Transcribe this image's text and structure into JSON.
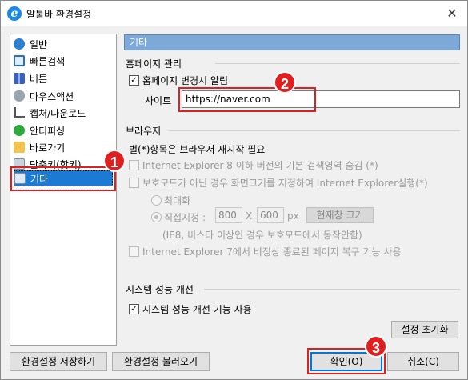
{
  "window": {
    "title": "알툴바 환경설정",
    "close_glyph": "✕"
  },
  "sidebar": {
    "items": [
      {
        "label": "일반",
        "icon": "general-icon"
      },
      {
        "label": "빠른검색",
        "icon": "quick-search-icon"
      },
      {
        "label": "버튼",
        "icon": "buttons-icon"
      },
      {
        "label": "마우스액션",
        "icon": "mouse-icon"
      },
      {
        "label": "캡처/다운로드",
        "icon": "capture-icon"
      },
      {
        "label": "안티피싱",
        "icon": "antiphishing-icon"
      },
      {
        "label": "바로가기",
        "icon": "shortcut-folder-icon"
      },
      {
        "label": "단축키(핫키)",
        "icon": "keyboard-icon"
      },
      {
        "label": "기타",
        "icon": "etc-icon",
        "selected": true
      }
    ]
  },
  "section": {
    "title": "기타"
  },
  "homepage": {
    "group_title": "홈페이지 관리",
    "notify_checkbox": "홈페이지 변경시 알림",
    "site_label": "사이트",
    "site_value": "https://naver.com"
  },
  "browser": {
    "group_title": "브라우저",
    "note": "별(*)항목은 브라우저 재시작 필요",
    "opt_ie8": "Internet Explorer 8 이하 버전의 기본 검색영역 숨김 (*)",
    "opt_protected": "보호모드가 아닌 경우 화면크기를 지정하여 Internet Explorer실행(*)",
    "radio_max": "최대화",
    "radio_custom": "직접지정 :",
    "width_value": "800",
    "times": "X",
    "height_value": "600",
    "unit": "px",
    "current_size_button": "현재창 크기",
    "ie8_note": "(IE8, 비스타 이상인 경우 보호모드에서 동작안함)",
    "opt_ie7": "Internet Explorer 7에서 비정상 종료된 페이지 복구 기능 사용"
  },
  "performance": {
    "group_title": "시스템 성능 개선",
    "checkbox": "시스템 성능 개선 기능 사용",
    "reset_button": "설정 초기화"
  },
  "footer": {
    "save_button": "환경설정 저장하기",
    "load_button": "환경설정 불러오기",
    "ok_button": "확인(O)",
    "cancel_button": "취소(C)"
  },
  "annotations": {
    "badge1": "1",
    "badge2": "2",
    "badge3": "3"
  },
  "colors": {
    "accent": "#1a7ad4",
    "header": "#7da9d8",
    "annotation": "#e02020"
  }
}
